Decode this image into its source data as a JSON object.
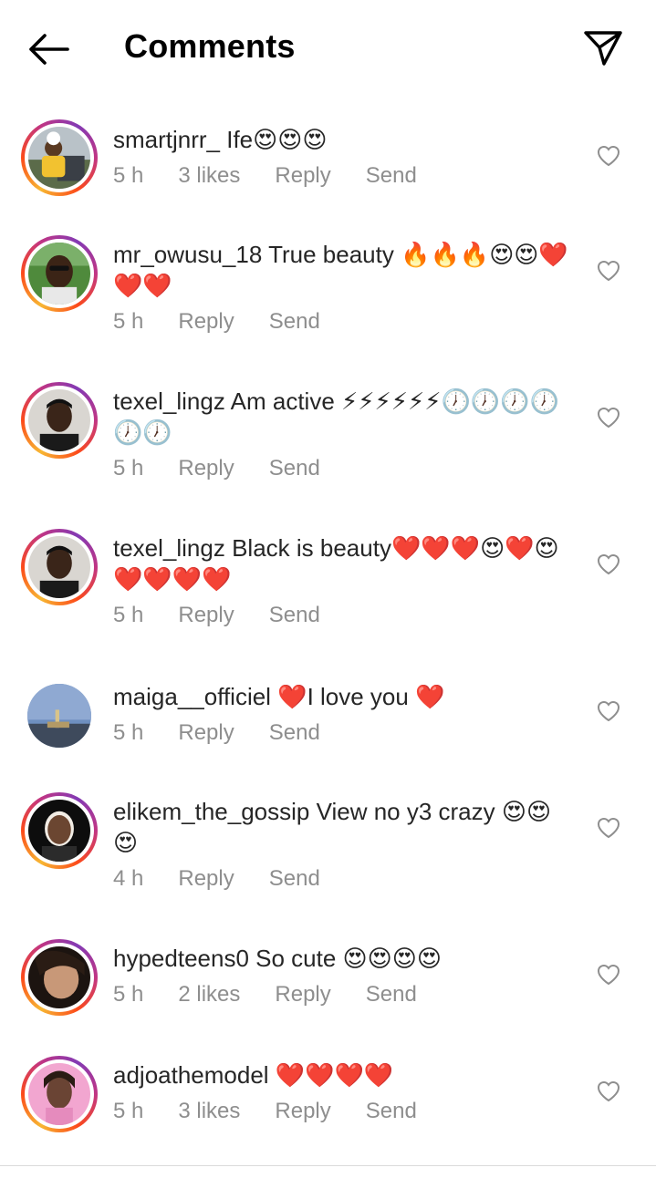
{
  "header": {
    "title": "Comments",
    "back_icon": "arrow-left-icon",
    "send_icon": "paper-plane-icon"
  },
  "comments": [
    {
      "username": "smartjnrr_",
      "text": " Ife😍😍😍",
      "time": "5 h",
      "likes": "3 likes",
      "reply": "Reply",
      "send": "Send"
    },
    {
      "username": "mr_owusu_18",
      "text": " True beauty 🔥🔥🔥😍😍❤️❤️❤️",
      "time": "5 h",
      "likes": "",
      "reply": "Reply",
      "send": "Send"
    },
    {
      "username": "texel_lingz",
      "text": " Am active ⚡⚡⚡⚡⚡⚡🕖🕖🕖🕖🕖🕖",
      "time": "5 h",
      "likes": "",
      "reply": "Reply",
      "send": "Send"
    },
    {
      "username": "texel_lingz",
      "text": " Black is beauty❤️❤️❤️😍❤️😍❤️❤️❤️❤️",
      "time": "5 h",
      "likes": "",
      "reply": "Reply",
      "send": "Send"
    },
    {
      "username": "maiga__officiel",
      "text": " ❤️I love you ❤️",
      "time": "5 h",
      "likes": "",
      "reply": "Reply",
      "send": "Send"
    },
    {
      "username": "elikem_the_gossip",
      "text": " View no y3 crazy 😍😍😍",
      "time": "4 h",
      "likes": "",
      "reply": "Reply",
      "send": "Send"
    },
    {
      "username": "hypedteens0",
      "text": " So cute 😍😍😍😍",
      "time": "5 h",
      "likes": "2 likes",
      "reply": "Reply",
      "send": "Send"
    },
    {
      "username": "adjoathemodel",
      "text": " ❤️❤️❤️❤️",
      "time": "5 h",
      "likes": "3 likes",
      "reply": "Reply",
      "send": "Send"
    }
  ],
  "colors": {
    "text": "#262626",
    "meta": "#8e8e8e",
    "story_ring_start": "#f7b733",
    "story_ring_end": "#c13584"
  }
}
